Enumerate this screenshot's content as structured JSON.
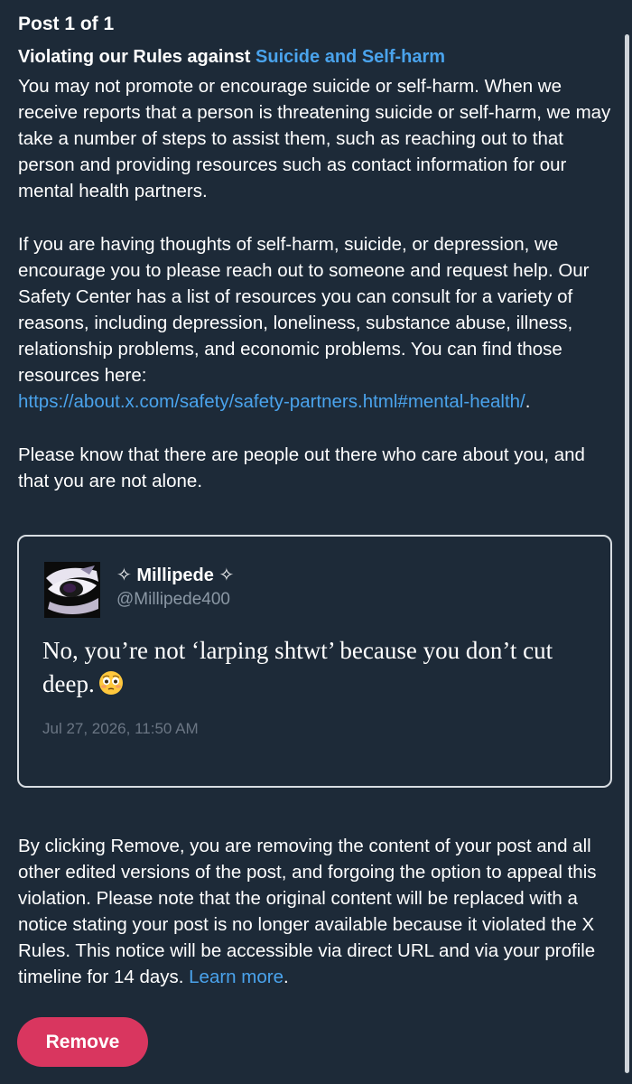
{
  "header": {
    "post_counter": "Post 1 of 1",
    "rule_prefix": "Violating our Rules against ",
    "rule_link": "Suicide and Self-harm"
  },
  "policy": {
    "paragraph1": "You may not promote or encourage suicide or self-harm. When we receive reports that a person is threatening suicide or self-harm, we may take a number of steps to assist them, such as reaching out to that person and providing resources such as contact information for our mental health partners.",
    "paragraph2": "If you are having thoughts of self-harm, suicide, or depression, we encourage you to please reach out to someone and request help. Our Safety Center has a list of resources you can consult for a variety of reasons, including depression, loneliness, substance abuse, illness, relationship problems, and economic problems. You can find those resources here:",
    "resource_url": "https://about.x.com/safety/safety-partners.html#mental-health/",
    "resource_url_suffix": ".",
    "paragraph3": "Please know that there are people out there who care about you, and that you are not alone."
  },
  "quoted_post": {
    "display_name": "✧ Millipede ✧",
    "handle": "@Millipede400",
    "text": "No, you’re not ‘larping shtwt’ because you don’t cut deep.",
    "emoji": "flushed-face-emoji",
    "timestamp": "Jul 27, 2026, 11:50 AM"
  },
  "footer": {
    "notice": "By clicking Remove, you are removing the content of your post and all other edited versions of the post, and forgoing the option to appeal this violation. Please note that the original content will be replaced with a notice stating your post is no longer available because it violated the X Rules. This notice will be accessible via direct URL and via your profile timeline for 14 days.",
    "learn_more": "Learn more",
    "learn_more_suffix": ".",
    "remove_label": "Remove"
  },
  "colors": {
    "background": "#1d2a38",
    "link": "#4aa3ec",
    "remove_button": "#d9365f",
    "muted_text": "#8b98a5"
  }
}
